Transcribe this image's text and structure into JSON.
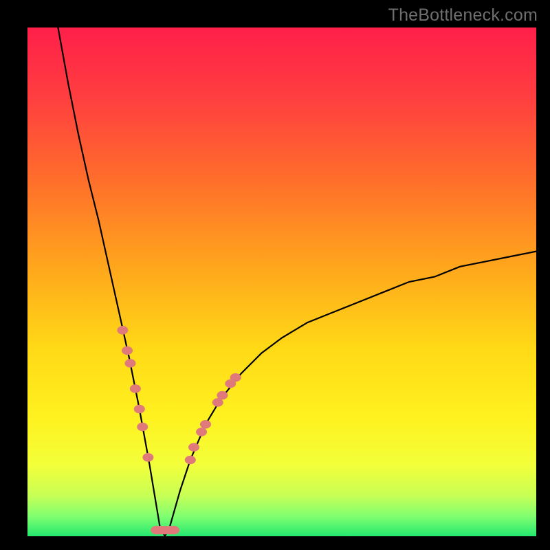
{
  "watermark": "TheBottleneck.com",
  "chart_data": {
    "type": "line",
    "title": "",
    "xlabel": "",
    "ylabel": "",
    "x_range": [
      0,
      100
    ],
    "y_range": [
      0,
      100
    ],
    "minimum_x": 27,
    "curve": {
      "description": "Absolute bottleneck percentage vs component balance; minimum (0%) near x≈27, rising steeply on both sides (left branch starts at y=100 at x≈6; right branch reaches y≈56 at x=100).",
      "left_branch_x": [
        6,
        8,
        10,
        12,
        14,
        16,
        18,
        20,
        22,
        24,
        25,
        26,
        27
      ],
      "left_branch_y": [
        100,
        89,
        79,
        70,
        62,
        53,
        44,
        35,
        25,
        14,
        8,
        2,
        0
      ],
      "right_branch_x": [
        27,
        28,
        30,
        32,
        35,
        38,
        42,
        46,
        50,
        55,
        60,
        65,
        70,
        75,
        80,
        85,
        90,
        95,
        100
      ],
      "right_branch_y": [
        0,
        2,
        9,
        15,
        22,
        27,
        32,
        36,
        39,
        42,
        44,
        46,
        48,
        50,
        51,
        53,
        54,
        55,
        56
      ]
    },
    "markers": {
      "description": "Highlighted sample points near the minimum on both branches plus the flat bottom.",
      "color": "#e07a7a",
      "radius_px": 8,
      "points": [
        {
          "x": 18.7,
          "y": 40.5
        },
        {
          "x": 19.6,
          "y": 36.5
        },
        {
          "x": 20.2,
          "y": 34.0
        },
        {
          "x": 21.2,
          "y": 29.0
        },
        {
          "x": 22.0,
          "y": 25.0
        },
        {
          "x": 22.6,
          "y": 21.5
        },
        {
          "x": 23.7,
          "y": 15.5
        },
        {
          "x": 25.3,
          "y": 1.2
        },
        {
          "x": 26.2,
          "y": 1.2
        },
        {
          "x": 27.0,
          "y": 1.2
        },
        {
          "x": 28.0,
          "y": 1.2
        },
        {
          "x": 28.8,
          "y": 1.2
        },
        {
          "x": 32.0,
          "y": 15.0
        },
        {
          "x": 32.7,
          "y": 17.5
        },
        {
          "x": 34.2,
          "y": 20.5
        },
        {
          "x": 35.0,
          "y": 22.0
        },
        {
          "x": 37.4,
          "y": 26.3
        },
        {
          "x": 38.3,
          "y": 27.7
        },
        {
          "x": 39.9,
          "y": 30.0
        },
        {
          "x": 40.9,
          "y": 31.2
        }
      ]
    },
    "gradient_stops": [
      {
        "offset": 0.0,
        "color": "#ff1f4a"
      },
      {
        "offset": 0.14,
        "color": "#ff3f3f"
      },
      {
        "offset": 0.3,
        "color": "#ff6e2b"
      },
      {
        "offset": 0.47,
        "color": "#ffa61c"
      },
      {
        "offset": 0.63,
        "color": "#ffd916"
      },
      {
        "offset": 0.77,
        "color": "#fff220"
      },
      {
        "offset": 0.86,
        "color": "#f3ff3a"
      },
      {
        "offset": 0.92,
        "color": "#c7ff55"
      },
      {
        "offset": 0.96,
        "color": "#82ff70"
      },
      {
        "offset": 1.0,
        "color": "#24e86f"
      }
    ]
  }
}
